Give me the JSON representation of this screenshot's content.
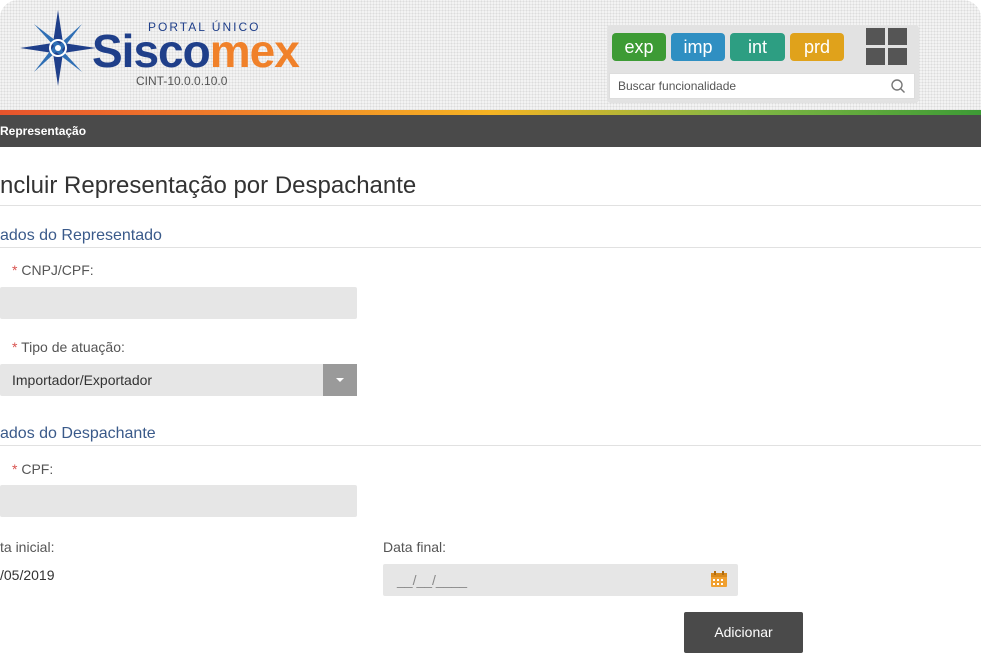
{
  "header": {
    "portal_label": "PORTAL ÚNICO",
    "brand_part1": "Sisco",
    "brand_part2": "mex",
    "version": "CINT-10.0.0.10.0",
    "env_buttons": [
      {
        "label": "exp",
        "color": "#3d9b35"
      },
      {
        "label": "imp",
        "color": "#2f8fc2"
      },
      {
        "label": "int",
        "color": "#2d9e82"
      },
      {
        "label": "prd",
        "color": "#e0a21b"
      }
    ],
    "search": {
      "placeholder": "Buscar funcionalidade",
      "icon": "search-icon"
    },
    "apps_icon": "grid-icon"
  },
  "breadcrumb": "Representação",
  "page": {
    "title": "ncluir Representação por Despachante",
    "section_representado": "ados do Representado",
    "cnpj_label": "CNPJ/CPF:",
    "cnpj_value": "",
    "tipo_label": "Tipo de atuação:",
    "tipo_value": "Importador/Exportador",
    "section_despachante": "ados do Despachante",
    "cpf_label": "CPF:",
    "cpf_value": "",
    "data_inicial_label": "ta inicial:",
    "data_inicial_value": "/05/2019",
    "data_final_label": "Data final:",
    "data_final_mask": "__/__/____",
    "required_mark": "*",
    "add_button": "Adicionar"
  },
  "colors": {
    "brand_blue": "#1f3f8a",
    "brand_orange": "#f0812a",
    "dark_bar": "#4a4a4a",
    "required": "#d9534f"
  }
}
